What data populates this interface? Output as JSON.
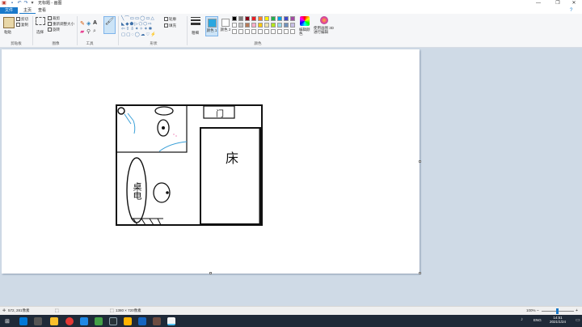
{
  "window": {
    "title": "无标题 - 画图",
    "controls": {
      "minimize": "—",
      "maximize": "❐",
      "close": "✕"
    }
  },
  "menu": {
    "file": "文件",
    "home": "主页",
    "view": "查看"
  },
  "ribbon": {
    "clipboard": {
      "paste": "粘贴",
      "cut": "剪切",
      "copy": "复制",
      "label": "剪贴板"
    },
    "image": {
      "select": "选择",
      "crop": "裁剪",
      "resize": "重新调整大小",
      "rotate": "旋转",
      "label": "图像"
    },
    "tools": {
      "label": "工具"
    },
    "brushes": {
      "label": "刷子"
    },
    "shapes": {
      "outline": "轮廓",
      "fill": "填充",
      "label": "形状"
    },
    "size": {
      "label": "粗细"
    },
    "colors": {
      "color1": "颜色 1",
      "color2": "颜色 2",
      "edit": "编辑颜色",
      "paint3d": "使用画图 3D 进行编辑",
      "label": "颜色"
    },
    "palette": [
      "#000000",
      "#7f7f7f",
      "#880015",
      "#ed1c24",
      "#ff7f27",
      "#fff200",
      "#22b14c",
      "#00a2e8",
      "#3f48cc",
      "#a349a4",
      "#ffffff",
      "#c3c3c3",
      "#b97a57",
      "#ffaec9",
      "#ffc90e",
      "#efe4b0",
      "#b5e61d",
      "#99d9ea",
      "#7092be",
      "#c8bfe7",
      "#ffffff",
      "#ffffff",
      "#ffffff",
      "#ffffff",
      "#ffffff",
      "#ffffff",
      "#ffffff",
      "#ffffff",
      "#ffffff",
      "#ffffff"
    ],
    "color1_value": "#2aa7e0",
    "color2_value": "#ffffff"
  },
  "drawing": {
    "door_label": "门",
    "bed_label": "床",
    "desk_label": "桌电"
  },
  "status": {
    "cursor": "572, 281像素",
    "canvas_size": "1380 × 720像素",
    "zoom": "100%"
  },
  "taskbar": {
    "ime": "ENG",
    "time": "14:51",
    "date": "2021/1/24"
  }
}
